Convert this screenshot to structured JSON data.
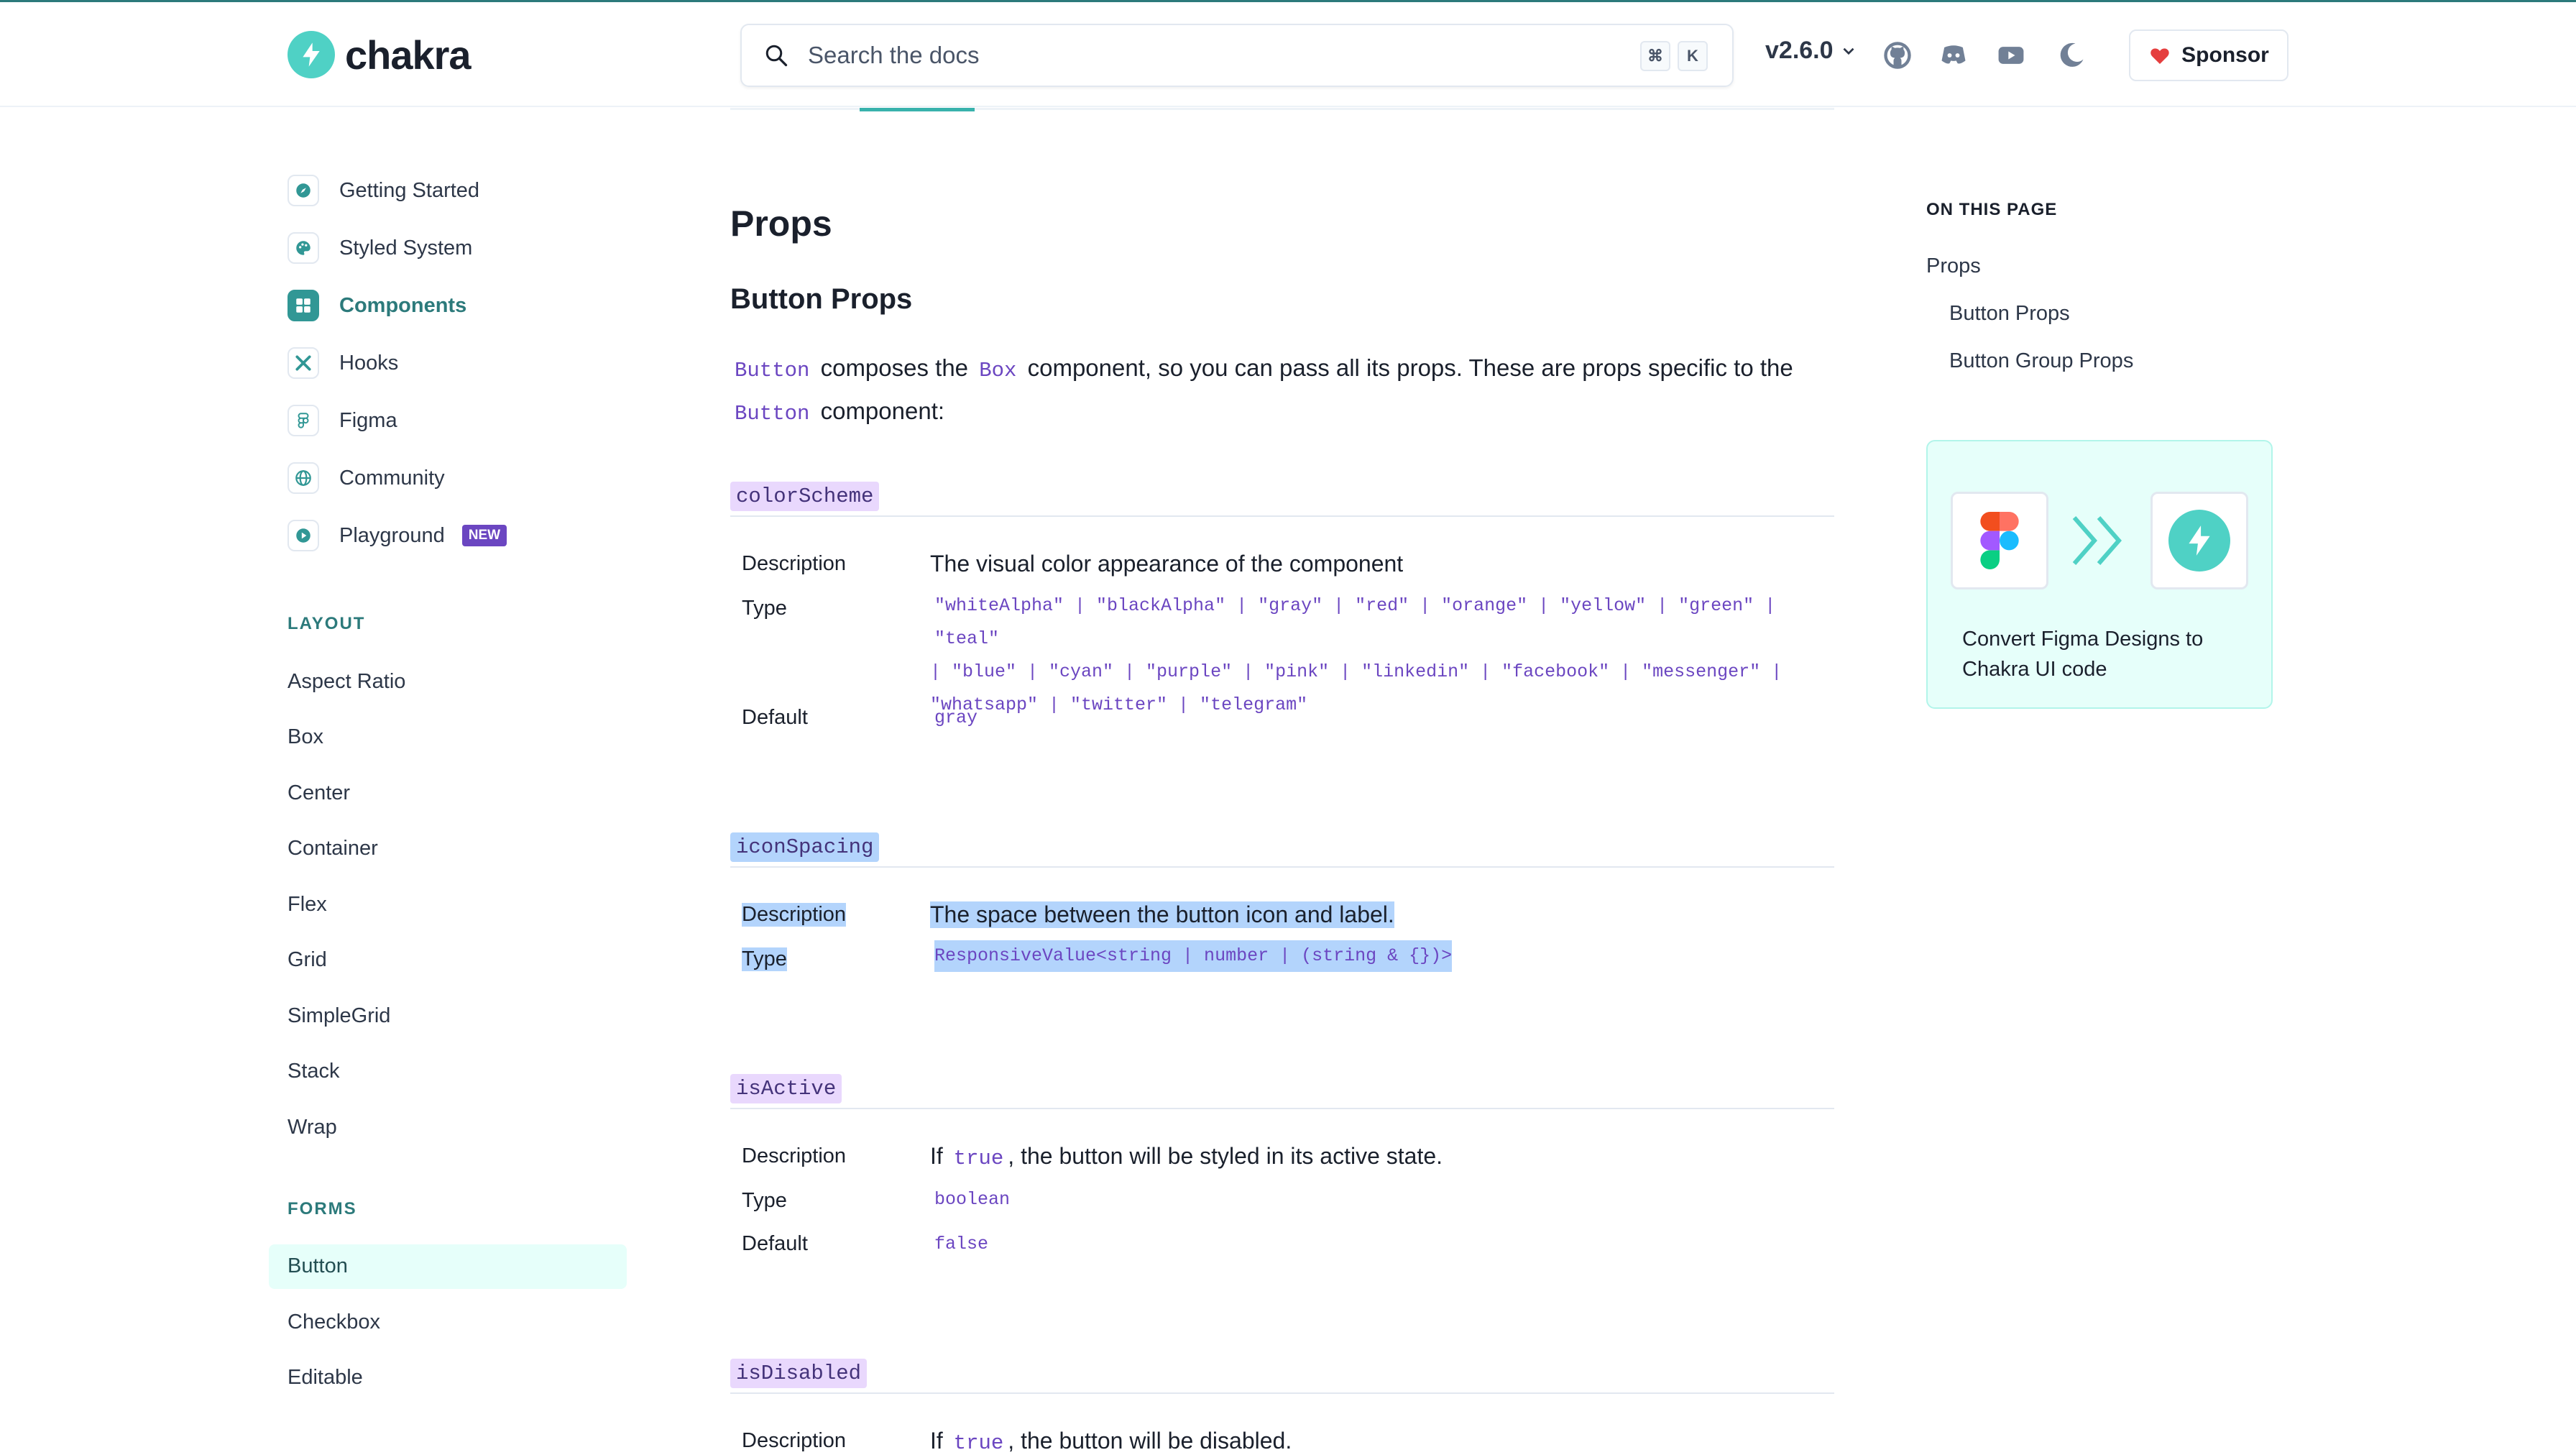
{
  "header": {
    "logo_text": "chakra",
    "search_placeholder": "Search the docs",
    "kbd_cmd": "⌘",
    "kbd_k": "K",
    "version": "v2.6.0",
    "sponsor_label": "Sponsor"
  },
  "sidebar": {
    "main_items": [
      {
        "label": "Getting Started",
        "icon": "compass-icon"
      },
      {
        "label": "Styled System",
        "icon": "palette-icon"
      },
      {
        "label": "Components",
        "icon": "grid-icon"
      },
      {
        "label": "Hooks",
        "icon": "tools-icon"
      },
      {
        "label": "Figma",
        "icon": "figma-icon"
      },
      {
        "label": "Community",
        "icon": "globe-icon"
      },
      {
        "label": "Playground",
        "icon": "play-icon"
      }
    ],
    "new_badge": "NEW",
    "layout_title": "LAYOUT",
    "layout_items": [
      "Aspect Ratio",
      "Box",
      "Center",
      "Container",
      "Flex",
      "Grid",
      "SimpleGrid",
      "Stack",
      "Wrap"
    ],
    "forms_title": "FORMS",
    "forms_items": [
      "Button",
      "Checkbox",
      "Editable"
    ]
  },
  "main": {
    "heading": "Props",
    "subheading": "Button Props",
    "intro": {
      "code_button": "Button",
      "text1": "composes the",
      "code_box": "Box",
      "text2": "component, so you can pass all its props. These are props specific to the",
      "code_button2": "Button",
      "text3": "component:"
    },
    "labels": {
      "description": "Description",
      "type": "Type",
      "default": "Default"
    },
    "props": {
      "colorScheme": {
        "name": "colorScheme",
        "description": "The visual color appearance of the component",
        "type_line1": "\"whiteAlpha\" | \"blackAlpha\" | \"gray\" | \"red\" | \"orange\" | \"yellow\" | \"green\" | \"teal\"",
        "type_line2": "| \"blue\" | \"cyan\" | \"purple\" | \"pink\" | \"linkedin\" | \"facebook\" | \"messenger\" |",
        "type_line3": "\"whatsapp\" | \"twitter\" | \"telegram\"",
        "default": "gray"
      },
      "iconSpacing": {
        "name": "iconSpacing",
        "description": "The space between the button icon and label.",
        "type": "ResponsiveValue<string | number | (string & {})>"
      },
      "isActive": {
        "name": "isActive",
        "desc_pre": "If",
        "desc_code": "true",
        "desc_post": ", the button will be styled in its active state.",
        "type": "boolean",
        "default": "false"
      },
      "isDisabled": {
        "name": "isDisabled",
        "desc_pre": "If",
        "desc_code": "true",
        "desc_post": ", the button will be disabled."
      }
    }
  },
  "toc": {
    "title": "ON THIS PAGE",
    "items": [
      "Props",
      "Button Props",
      "Button Group Props"
    ]
  },
  "promo": {
    "line1": "Convert Figma Designs to",
    "line2": "Chakra UI code"
  },
  "colors": {
    "accent": "#319795",
    "code": "#6b46c1",
    "selection": "#b3d4fc"
  }
}
